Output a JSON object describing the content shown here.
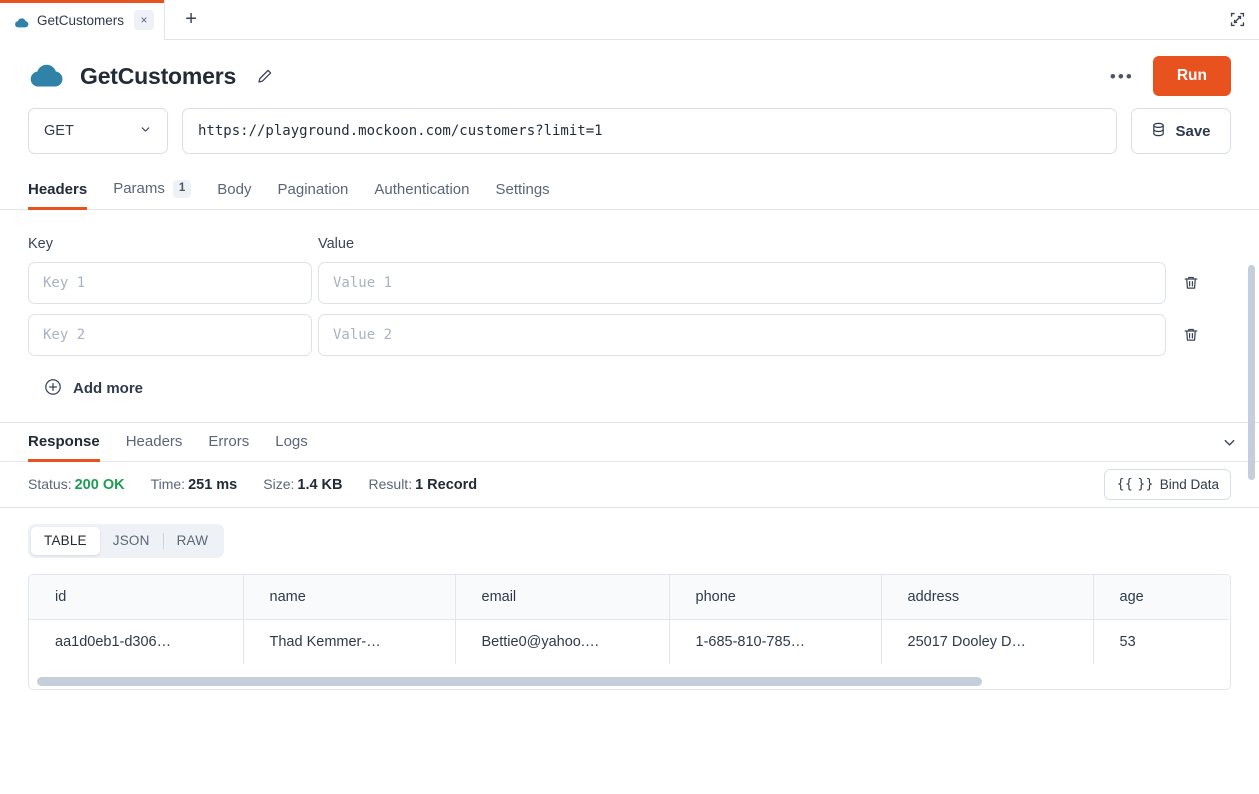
{
  "tabbar": {
    "tabs": [
      {
        "label": "GetCustomers",
        "icon": "cloud-icon",
        "close_label": "×"
      }
    ],
    "new_tab_label": "+",
    "collapse_icon": "collapse-panel-icon"
  },
  "header": {
    "icon": "cloud-icon",
    "title": "GetCustomers",
    "edit_icon": "pencil-icon",
    "more_label": "•••",
    "run_label": "Run",
    "run_color": "#e8521f"
  },
  "request": {
    "method": "GET",
    "method_chevron": "chevron-down-icon",
    "url": "https://playground.mockoon.com/customers?limit=1",
    "url_placeholder": "https://",
    "save_label": "Save",
    "save_icon": "database-icon",
    "tabs": [
      {
        "label": "Headers",
        "badge": "",
        "active": true
      },
      {
        "label": "Params",
        "badge": "1",
        "active": false
      },
      {
        "label": "Body",
        "badge": "",
        "active": false
      },
      {
        "label": "Pagination",
        "badge": "",
        "active": false
      },
      {
        "label": "Authentication",
        "badge": "",
        "active": false
      },
      {
        "label": "Settings",
        "badge": "",
        "active": false
      }
    ]
  },
  "headers_panel": {
    "col_key": "Key",
    "col_value": "Value",
    "rows": [
      {
        "key_value": "",
        "key_placeholder": "Key 1",
        "value_value": "",
        "value_placeholder": "Value 1",
        "delete_icon": "trash-icon"
      },
      {
        "key_value": "",
        "key_placeholder": "Key 2",
        "value_value": "",
        "value_placeholder": "Value 2",
        "delete_icon": "trash-icon"
      }
    ],
    "add_more_label": "Add more",
    "add_more_icon": "plus-circle-icon"
  },
  "response": {
    "tabs": [
      {
        "label": "Response",
        "active": true
      },
      {
        "label": "Headers",
        "active": false
      },
      {
        "label": "Errors",
        "active": false
      },
      {
        "label": "Logs",
        "active": false
      }
    ],
    "collapse_chevron": "chevron-down-icon",
    "status_label": "Status:",
    "status_value": "200 OK",
    "status_color": "#1f9b54",
    "time_label": "Time:",
    "time_value": "251 ms",
    "size_label": "Size:",
    "size_value": "1.4 KB",
    "result_label": "Result:",
    "result_value": "1 Record",
    "bind_data_label": "Bind Data",
    "bind_data_braces": "{{ }}",
    "view_modes": [
      {
        "label": "TABLE",
        "active": true
      },
      {
        "label": "JSON",
        "active": false
      },
      {
        "label": "RAW",
        "active": false
      }
    ],
    "table": {
      "columns": [
        "id",
        "name",
        "email",
        "phone",
        "address",
        "age"
      ],
      "rows": [
        {
          "id": "aa1d0eb1-d306…",
          "name": "Thad Kemmer-…",
          "email": "Bettie0@yahoo.…",
          "phone": "1-685-810-785…",
          "address": "25017 Dooley D…",
          "age": "53"
        }
      ]
    }
  }
}
